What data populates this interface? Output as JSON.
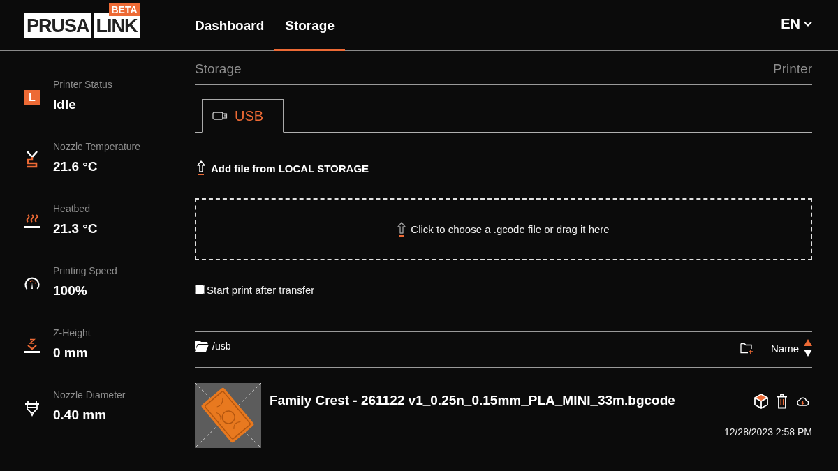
{
  "header": {
    "logo": {
      "tiles": [
        "PRUSA",
        "LINK"
      ],
      "badge": "BETA"
    },
    "nav": [
      {
        "label": "Dashboard",
        "selected": false
      },
      {
        "label": "Storage",
        "selected": true
      }
    ],
    "language": "EN"
  },
  "sidebar": {
    "items": [
      {
        "kind": "status",
        "label": "Printer Status",
        "value": "Idle",
        "badge": "L"
      },
      {
        "kind": "nozzle",
        "label": "Nozzle Temperature",
        "value": "21.6 °C"
      },
      {
        "kind": "heatbed",
        "label": "Heatbed",
        "value": "21.3 °C"
      },
      {
        "kind": "speed",
        "label": "Printing Speed",
        "value": "100%"
      },
      {
        "kind": "z_height",
        "label": "Z-Height",
        "value": "0 mm"
      },
      {
        "kind": "nozzle_diameter",
        "label": "Nozzle Diameter",
        "value": "0.40 mm"
      }
    ]
  },
  "storage": {
    "title": "Storage",
    "printer": "Printer",
    "tabs": [
      {
        "label": "USB",
        "selected": true
      }
    ],
    "add_file": "Add file from LOCAL STORAGE",
    "drop_zone": "Click to choose a .gcode file or drag it here",
    "start_print": {
      "label": "Start print after transfer",
      "checked": false
    },
    "path": "/usb",
    "sort": {
      "label": "Name",
      "ascending": true
    },
    "files": [
      {
        "name": "Family Crest - 261122 v1_0.25n_0.15mm_PLA_MINI_33m.bgcode",
        "date": "12/28/2023 2:58 PM"
      }
    ]
  }
}
